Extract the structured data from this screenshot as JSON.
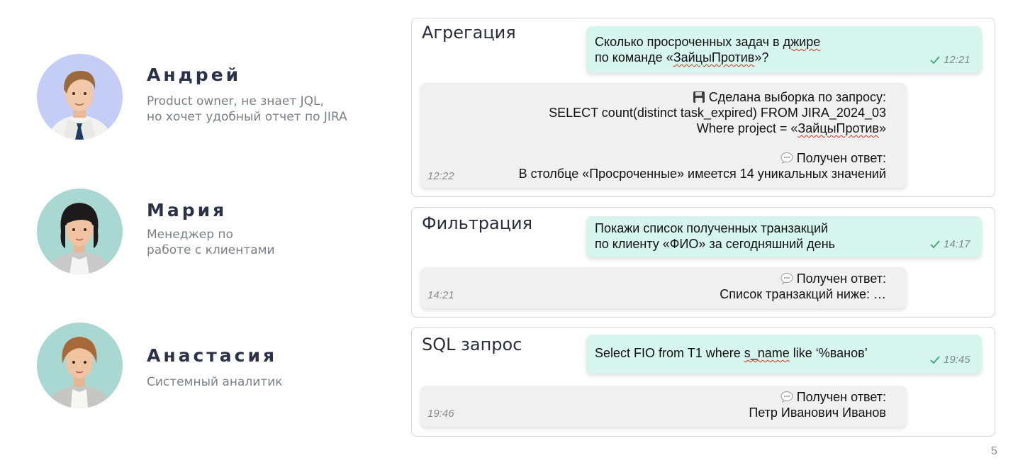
{
  "personas": [
    {
      "name": "Андрей",
      "desc1": "Product owner, не знает JQL,",
      "desc2": "но хочет удобный отчет по JIRA"
    },
    {
      "name": "Мария",
      "desc1": "Менеджер по",
      "desc2": "работе с клиентами"
    },
    {
      "name": "Анастасия",
      "desc1": "Системный аналитик"
    }
  ],
  "cards": [
    {
      "title": "Агрегация",
      "question_lines": [
        "Сколько просроченных задач в джире",
        "по команде «ЗайцыПротив»?"
      ],
      "question_time": "12:21",
      "answer_sql_label": "Сделана выборка по запросу:",
      "answer_sql_1": "SELECT count(distinct task_expired) FROM JIRA_2024_03",
      "answer_sql_2_prefix": "Where project = «",
      "answer_sql_2_word": "ЗайцыПротив",
      "answer_sql_2_suffix": "»",
      "answer_label": "Получен ответ:",
      "answer_text": "В столбце «Просроченные» имеется 14 уникальных значений",
      "answer_time": "12:22"
    },
    {
      "title": "Фильтрация",
      "question_lines": [
        "Покажи список полученных транзакций",
        "по клиенту «ФИО» за сегодняшний день"
      ],
      "question_time": "14:17",
      "answer_label": "Получен ответ:",
      "answer_text": "Список транзакций ниже: …",
      "answer_time": "14:21"
    },
    {
      "title": "SQL запрос",
      "question_lines": [
        "Select FIO from T1 where s_name like ‘%ванов’"
      ],
      "question_time": "19:45",
      "answer_label": "Получен ответ:",
      "answer_text": "Петр Иванович Иванов",
      "answer_time": "19:46"
    }
  ],
  "page_number": "5",
  "colors": {
    "question_bubble": "#d6f5ec",
    "answer_bubble": "#f0f0f0",
    "name": "#2b3147",
    "desc": "#7b7f88"
  }
}
